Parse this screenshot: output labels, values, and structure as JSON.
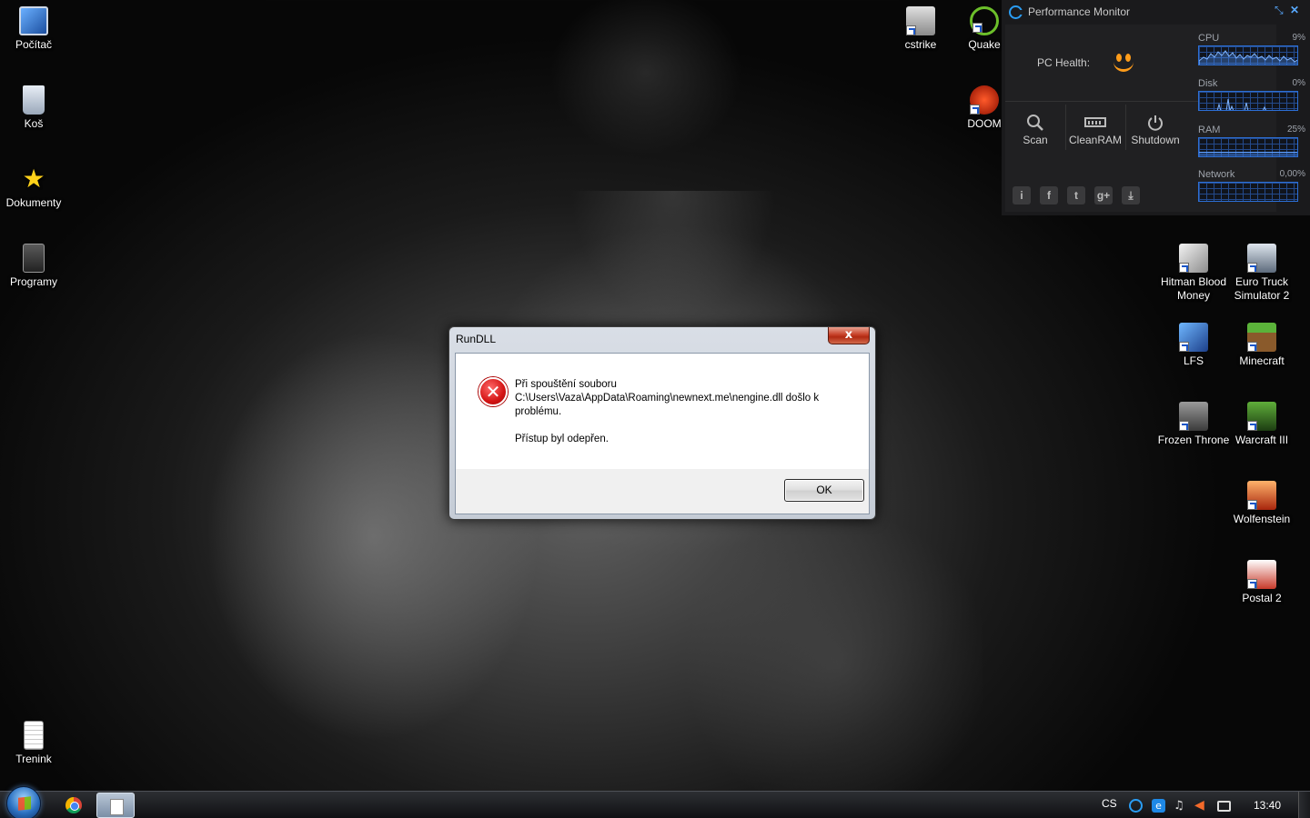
{
  "desktop": {
    "left_icons": [
      {
        "label": "Počítač",
        "icon": "computer-icon"
      },
      {
        "label": "Koš",
        "icon": "recycle-bin-icon"
      },
      {
        "label": "Dokumenty",
        "icon": "documents-star-icon"
      },
      {
        "label": "Programy",
        "icon": "programs-icon"
      },
      {
        "label": "Trenink",
        "icon": "text-file-icon"
      }
    ],
    "top_icons": [
      {
        "label": "cstrike",
        "icon": "counter-strike-icon"
      },
      {
        "label": "Quake",
        "icon": "quake-icon"
      },
      {
        "label": "DOOM",
        "icon": "doom-icon"
      }
    ],
    "right_icons": [
      {
        "label": "Hitman Blood Money",
        "icon": "hitman-icon"
      },
      {
        "label": "Euro Truck Simulator 2",
        "icon": "truck-icon"
      },
      {
        "label": "LFS",
        "icon": "lfs-icon"
      },
      {
        "label": "Minecraft",
        "icon": "minecraft-icon"
      },
      {
        "label": "Frozen Throne",
        "icon": "frozen-throne-icon"
      },
      {
        "label": "Warcraft III",
        "icon": "warcraft-icon"
      },
      {
        "label": "Wolfenstein",
        "icon": "wolfenstein-icon"
      },
      {
        "label": "Postal 2",
        "icon": "postal-icon"
      }
    ]
  },
  "performance_monitor": {
    "title": "Performance Monitor",
    "pc_health_label": "PC Health:",
    "tools": [
      {
        "label": "Scan",
        "icon": "search-icon"
      },
      {
        "label": "CleanRAM",
        "icon": "ram-icon"
      },
      {
        "label": "Shutdown",
        "icon": "power-icon"
      }
    ],
    "social": [
      "info-icon",
      "facebook-icon",
      "tumblr-icon",
      "google-plus-icon",
      "download-icon"
    ],
    "meters": [
      {
        "name": "CPU",
        "value": "9%"
      },
      {
        "name": "Disk",
        "value": "0%"
      },
      {
        "name": "RAM",
        "value": "25%",
        "fill_percent": 25
      },
      {
        "name": "Network",
        "value": "0,00%"
      }
    ],
    "accent_color": "#2a9df4"
  },
  "dialog": {
    "title": "RunDLL",
    "close_label": "x",
    "message_line1": "Při spouštění souboru C:\\Users\\Vaza\\AppData\\Roaming\\newnext.me\\nengine.dll došlo k problému.",
    "message_line2": "Přístup byl odepřen.",
    "ok_label": "OK",
    "icon": "error-icon"
  },
  "taskbar": {
    "language": "CS",
    "clock": "13:40",
    "pinned": [
      "chrome-icon",
      "notepad-icon"
    ],
    "tray": [
      "cc-icon",
      "browser-e-icon",
      "speaker-icon",
      "flag-icon",
      "network-icon"
    ]
  }
}
